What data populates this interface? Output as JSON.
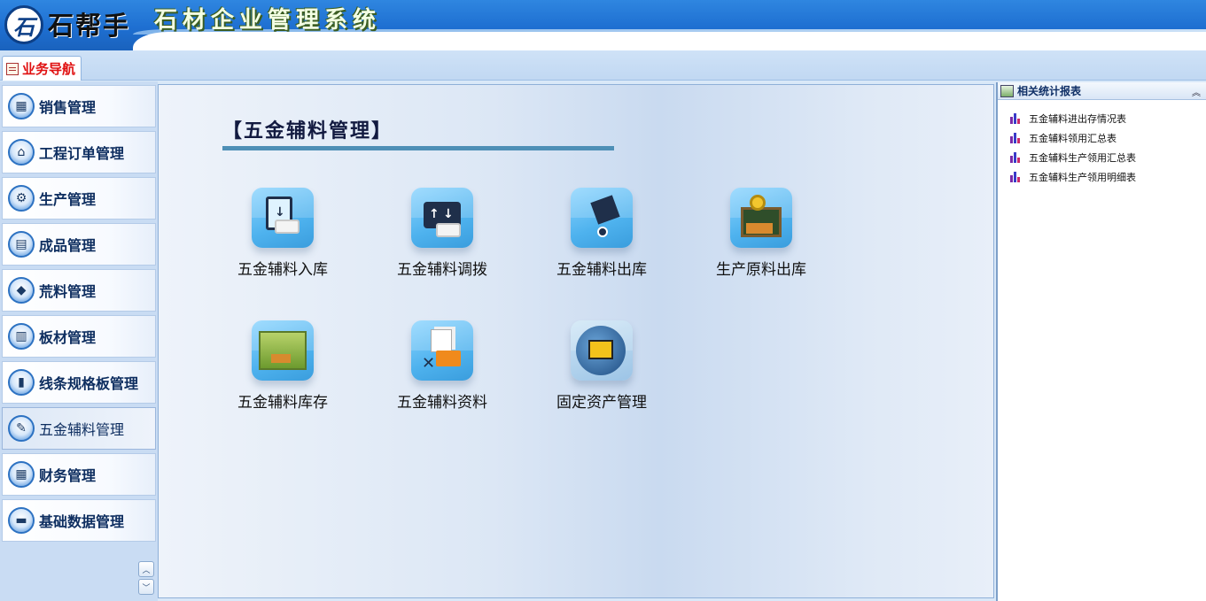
{
  "header": {
    "logo_glyph": "石",
    "brand": "石帮手",
    "system_title": "石材企业管理系统"
  },
  "tabs": [
    {
      "label": "业务导航",
      "icon": "note-icon"
    }
  ],
  "sidebar": {
    "items": [
      {
        "label": "销售管理",
        "icon": "sales-icon"
      },
      {
        "label": "工程订单管理",
        "icon": "project-icon"
      },
      {
        "label": "生产管理",
        "icon": "production-icon"
      },
      {
        "label": "成品管理",
        "icon": "finished-goods-icon"
      },
      {
        "label": "荒料管理",
        "icon": "raw-block-icon"
      },
      {
        "label": "板材管理",
        "icon": "slab-icon"
      },
      {
        "label": "线条规格板管理",
        "icon": "molding-icon"
      },
      {
        "label": "五金辅料管理",
        "icon": "hardware-icon",
        "active": true
      },
      {
        "label": "财务管理",
        "icon": "finance-icon"
      },
      {
        "label": "基础数据管理",
        "icon": "base-data-icon"
      }
    ],
    "scroll_up": "︿",
    "scroll_down": "﹀"
  },
  "main": {
    "title": "【五金辅料管理】",
    "tiles": [
      {
        "label": "五金辅料入库",
        "icon": "stock-in-icon"
      },
      {
        "label": "五金辅料调拨",
        "icon": "transfer-icon"
      },
      {
        "label": "五金辅料出库",
        "icon": "stock-out-icon"
      },
      {
        "label": "生产原料出库",
        "icon": "material-out-icon"
      },
      {
        "label": "五金辅料库存",
        "icon": "inventory-icon"
      },
      {
        "label": "五金辅料资料",
        "icon": "hardware-info-icon"
      },
      {
        "label": "固定资产管理",
        "icon": "fixed-asset-icon"
      }
    ]
  },
  "right_panel": {
    "title": "相关统计报表",
    "collapse": "︽",
    "reports": [
      {
        "label": "五金辅料进出存情况表"
      },
      {
        "label": "五金辅料领用汇总表"
      },
      {
        "label": "五金辅料生产领用汇总表"
      },
      {
        "label": "五金辅料生产领用明细表"
      }
    ]
  },
  "colors": {
    "header_blue": "#1e6fd1",
    "tab_label_red": "#e01010",
    "nav_text": "#0e2e60",
    "title_rule": "#4e8fb6"
  }
}
